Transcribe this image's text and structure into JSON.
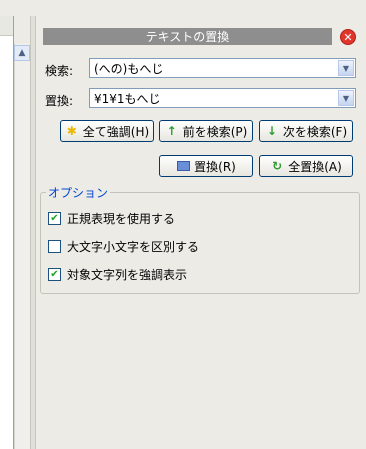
{
  "dialog": {
    "title": "テキストの置換",
    "close_symbol": "✕"
  },
  "search": {
    "label": "検索:",
    "value": "(への)もへじ"
  },
  "replace": {
    "label": "置換:",
    "value": "¥1¥1もへじ"
  },
  "buttons": {
    "highlight_all": "全て強調(H)",
    "find_prev": "前を検索(P)",
    "find_next": "次を検索(F)",
    "replace": "置換(R)",
    "replace_all": "全置換(A)"
  },
  "options": {
    "title": "オプション",
    "items": [
      {
        "label": "正規表現を使用する",
        "checked": true
      },
      {
        "label": "大文字小文字を区別する",
        "checked": false
      },
      {
        "label": "対象文字列を強調表示",
        "checked": true
      }
    ]
  },
  "colors": {
    "title_bar": "#8e8e8e",
    "close": "#e0352b",
    "options_title": "#0046d5"
  }
}
